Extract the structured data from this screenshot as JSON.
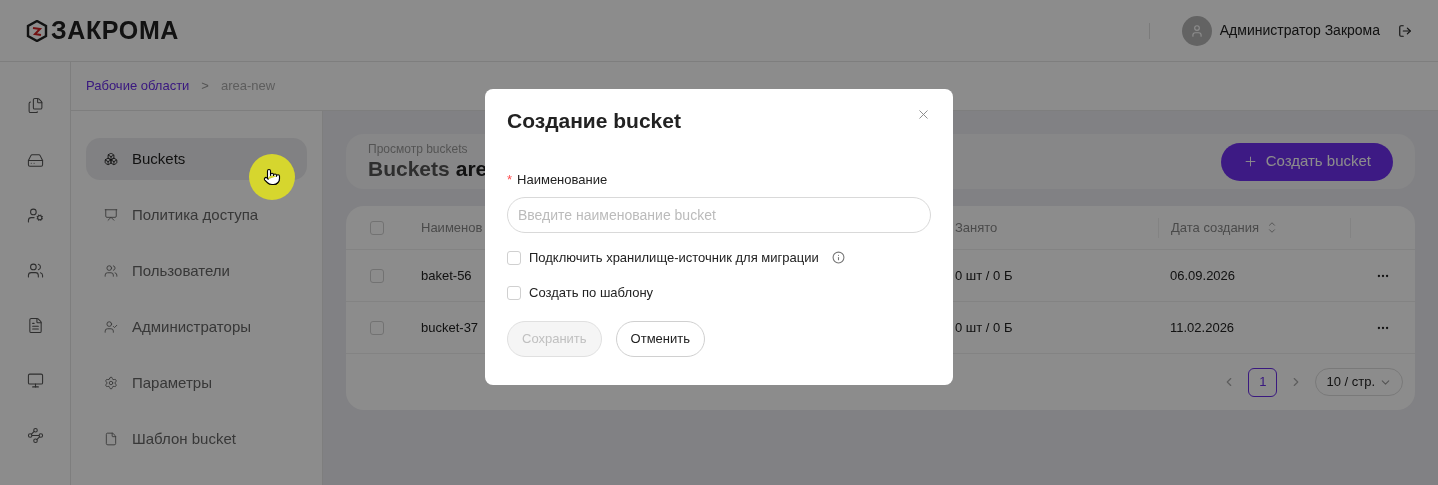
{
  "header": {
    "logo": "ЗАКРОМА",
    "user": "Администратор Закрома"
  },
  "breadcrumbs": [
    {
      "label": "Рабочие области",
      "kind": "link"
    },
    {
      "label": ">",
      "kind": "separator"
    },
    {
      "label": "area-new",
      "kind": "current"
    }
  ],
  "submenu": [
    {
      "label": "Buckets",
      "selected": true
    },
    {
      "label": "Политика доступа",
      "selected": false
    },
    {
      "label": "Пользователи",
      "selected": false
    },
    {
      "label": "Администраторы",
      "selected": false
    },
    {
      "label": "Параметры",
      "selected": false
    },
    {
      "label": "Шаблон bucket",
      "selected": false
    }
  ],
  "page": {
    "subtitle": "Просмотр buckets",
    "title": "Buckets",
    "title_suffix": "are",
    "create_button": "Создать bucket"
  },
  "table": {
    "select_all_checked": false,
    "columns": [
      "Наименов",
      "Занято",
      "Дата создания"
    ],
    "rows": [
      {
        "checked": false,
        "name": "baket-56",
        "occupied": "0 шт / 0 Б",
        "date": "06.09.2026"
      },
      {
        "checked": false,
        "name": "bucket-37",
        "occupied": "0 шт / 0 Б",
        "date": "11.02.2026"
      }
    ]
  },
  "pagination": {
    "pages": [
      {
        "label": "1",
        "selected": true
      }
    ],
    "page_size": "10 / стр."
  },
  "modal": {
    "title": "Создание bucket",
    "required_mark": "*",
    "field_label": "Наименование",
    "placeholder": "Введите наименование bucket",
    "options": [
      {
        "label": "Подключить хранилище-источник для миграции",
        "checked": false,
        "info": true
      },
      {
        "label": "Создать по шаблону",
        "checked": false,
        "info": false
      }
    ],
    "buttons": [
      {
        "label": "Сохранить",
        "disabled": true
      },
      {
        "label": "Отменить",
        "disabled": false
      }
    ]
  }
}
